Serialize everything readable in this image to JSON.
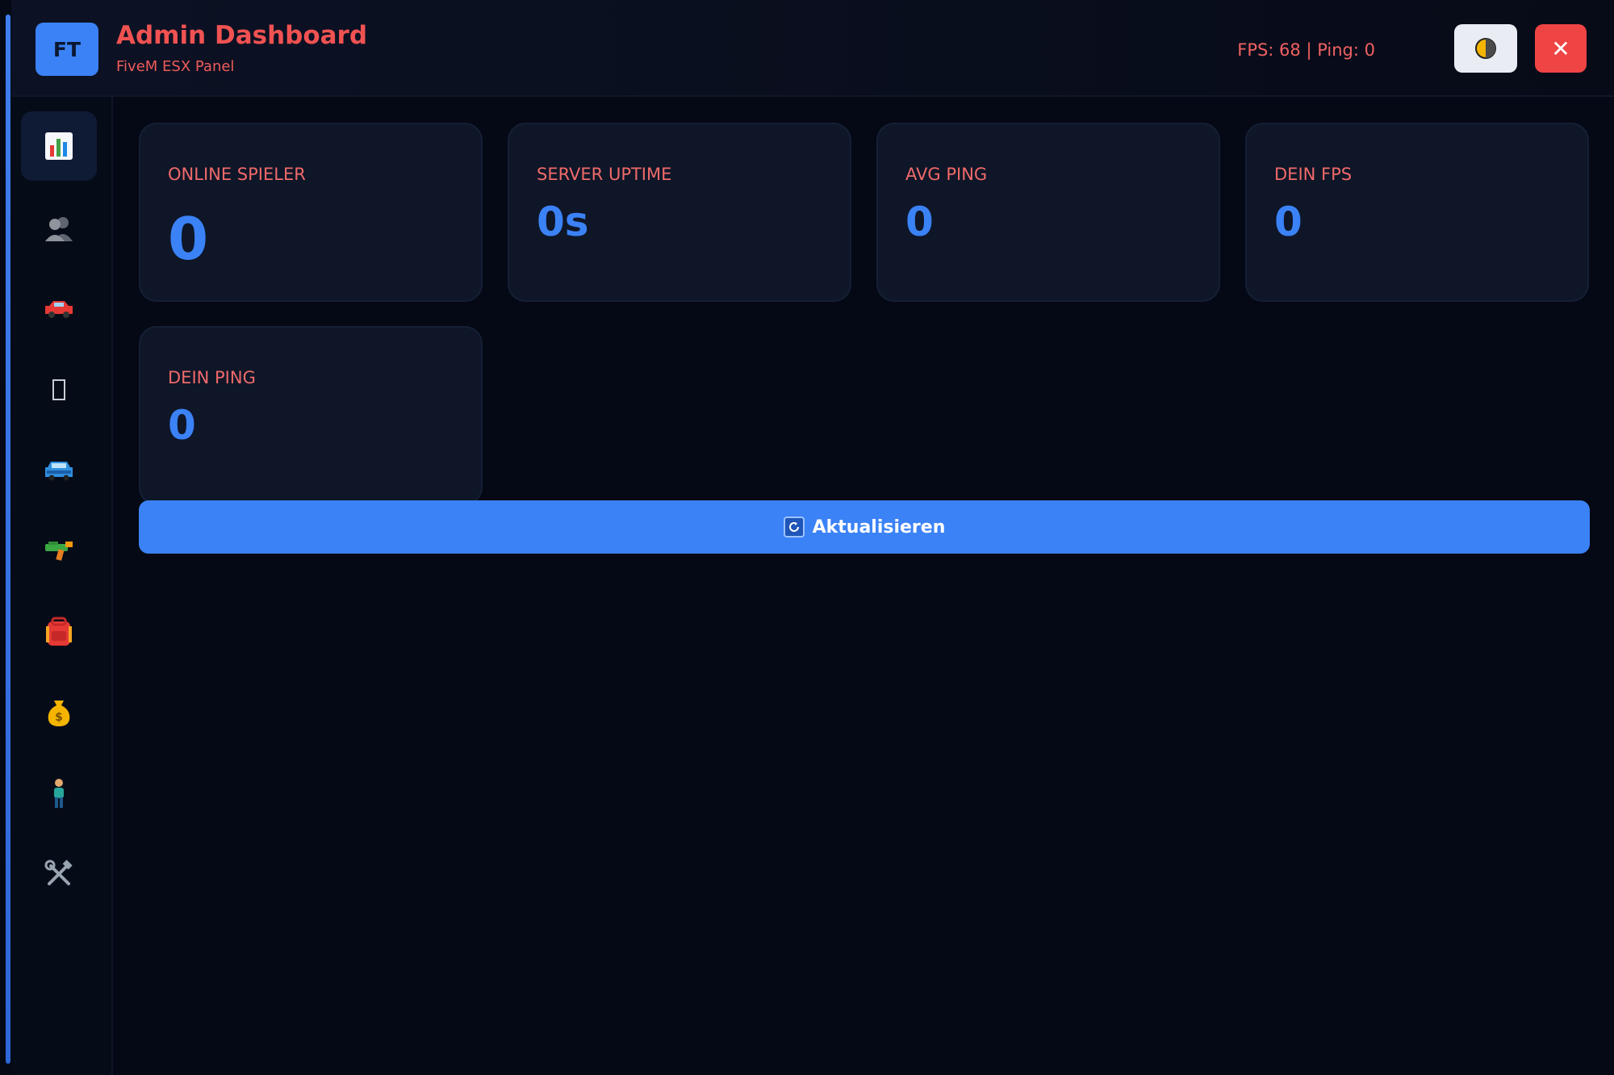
{
  "header": {
    "logo_text": "FT",
    "title": "Admin Dashboard",
    "subtitle": "FiveM ESX Panel",
    "stats": "FPS: 68 | Ping: 0",
    "theme_icon": "theme-toggle-icon",
    "close_label": "✕"
  },
  "sidebar": {
    "items": [
      {
        "name": "dashboard",
        "icon": "bar-chart-icon",
        "active": true
      },
      {
        "name": "players",
        "icon": "players-icon",
        "active": false
      },
      {
        "name": "vehicles",
        "icon": "car-icon",
        "active": false
      },
      {
        "name": "blank",
        "icon": "missing-glyph-icon",
        "active": false
      },
      {
        "name": "garage",
        "icon": "garage-car-icon",
        "active": false
      },
      {
        "name": "weapons",
        "icon": "gun-icon",
        "active": false
      },
      {
        "name": "inventory",
        "icon": "backpack-icon",
        "active": false
      },
      {
        "name": "money",
        "icon": "money-bag-icon",
        "active": false
      },
      {
        "name": "character",
        "icon": "person-icon",
        "active": false
      },
      {
        "name": "tools",
        "icon": "tools-icon",
        "active": false
      }
    ]
  },
  "stats": {
    "cards": [
      {
        "label": "ONLINE SPIELER",
        "value": "0"
      },
      {
        "label": "SERVER UPTIME",
        "value": "0s"
      },
      {
        "label": "AVG PING",
        "value": "0"
      },
      {
        "label": "DEIN FPS",
        "value": "0"
      },
      {
        "label": "DEIN PING",
        "value": "0"
      }
    ]
  },
  "actions": {
    "refresh_label": "Aktualisieren",
    "refresh_icon": "refresh-icon"
  },
  "colors": {
    "accent": "#3b82f6",
    "title_red": "#f05252",
    "close_red": "#ef4444",
    "background": "#050915",
    "card_bg": "#0e1628"
  }
}
